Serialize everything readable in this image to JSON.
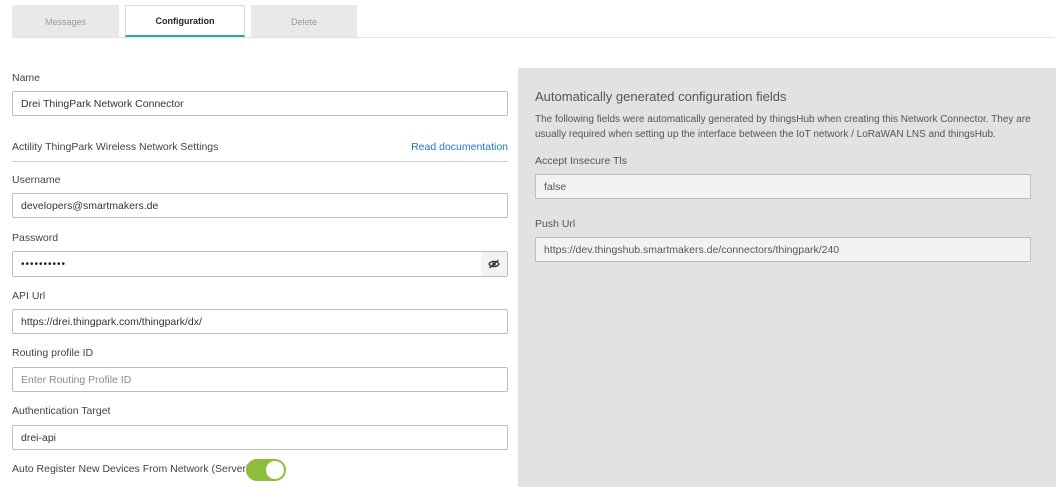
{
  "tabs": [
    {
      "label": "Messages"
    },
    {
      "label": "Configuration"
    },
    {
      "label": "Delete"
    }
  ],
  "form": {
    "name_label": "Name",
    "name_value": "Drei ThingPark Network Connector",
    "section_title": "Actility ThingPark Wireless Network Settings",
    "read_docs_link": "Read documentation",
    "username_label": "Username",
    "username_value": "developers@smartmakers.de",
    "password_label": "Password",
    "password_value": "••••••••••",
    "api_url_label": "API Url",
    "api_url_value": "https://drei.thingpark.com/thingpark/dx/",
    "routing_label": "Routing profile ID",
    "routing_placeholder": "Enter Routing Profile ID",
    "auth_label": "Authentication Target",
    "auth_value": "drei-api",
    "auto_register_label": "Auto Register New Devices From Network (Server)",
    "auto_register_on": true
  },
  "panel": {
    "title": "Automatically generated configuration fields",
    "description": "The following fields were automatically generated by thingsHub when creating this Network Connector. They are usually required when setting up the interface between the IoT network / LoRaWAN LNS and thingsHub.",
    "insecure_label": "Accept Insecure Tls",
    "insecure_value": "false",
    "push_label": "Push Url",
    "push_value": "https://dev.thingshub.smartmakers.de/connectors/thingpark/240"
  },
  "colors": {
    "accent_tab": "#1fa6c4",
    "link": "#2176c7",
    "toggle_on": "#8dbd3a",
    "panel_bg": "#e2e2e2"
  },
  "icons": {
    "password_toggle": "eye-off-icon"
  }
}
